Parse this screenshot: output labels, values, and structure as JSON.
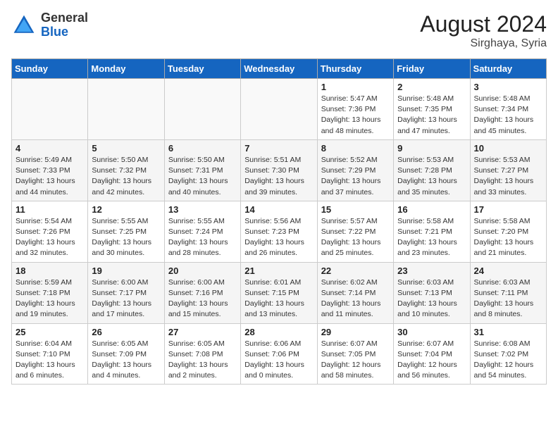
{
  "header": {
    "logo_general": "General",
    "logo_blue": "Blue",
    "month_year": "August 2024",
    "location": "Sirghaya, Syria"
  },
  "weekdays": [
    "Sunday",
    "Monday",
    "Tuesday",
    "Wednesday",
    "Thursday",
    "Friday",
    "Saturday"
  ],
  "weeks": [
    [
      {
        "day": "",
        "sunrise": "",
        "sunset": "",
        "daylight": "",
        "empty": true
      },
      {
        "day": "",
        "sunrise": "",
        "sunset": "",
        "daylight": "",
        "empty": true
      },
      {
        "day": "",
        "sunrise": "",
        "sunset": "",
        "daylight": "",
        "empty": true
      },
      {
        "day": "",
        "sunrise": "",
        "sunset": "",
        "daylight": "",
        "empty": true
      },
      {
        "day": "1",
        "sunrise": "Sunrise: 5:47 AM",
        "sunset": "Sunset: 7:36 PM",
        "daylight": "Daylight: 13 hours and 48 minutes.",
        "empty": false
      },
      {
        "day": "2",
        "sunrise": "Sunrise: 5:48 AM",
        "sunset": "Sunset: 7:35 PM",
        "daylight": "Daylight: 13 hours and 47 minutes.",
        "empty": false
      },
      {
        "day": "3",
        "sunrise": "Sunrise: 5:48 AM",
        "sunset": "Sunset: 7:34 PM",
        "daylight": "Daylight: 13 hours and 45 minutes.",
        "empty": false
      }
    ],
    [
      {
        "day": "4",
        "sunrise": "Sunrise: 5:49 AM",
        "sunset": "Sunset: 7:33 PM",
        "daylight": "Daylight: 13 hours and 44 minutes.",
        "empty": false
      },
      {
        "day": "5",
        "sunrise": "Sunrise: 5:50 AM",
        "sunset": "Sunset: 7:32 PM",
        "daylight": "Daylight: 13 hours and 42 minutes.",
        "empty": false
      },
      {
        "day": "6",
        "sunrise": "Sunrise: 5:50 AM",
        "sunset": "Sunset: 7:31 PM",
        "daylight": "Daylight: 13 hours and 40 minutes.",
        "empty": false
      },
      {
        "day": "7",
        "sunrise": "Sunrise: 5:51 AM",
        "sunset": "Sunset: 7:30 PM",
        "daylight": "Daylight: 13 hours and 39 minutes.",
        "empty": false
      },
      {
        "day": "8",
        "sunrise": "Sunrise: 5:52 AM",
        "sunset": "Sunset: 7:29 PM",
        "daylight": "Daylight: 13 hours and 37 minutes.",
        "empty": false
      },
      {
        "day": "9",
        "sunrise": "Sunrise: 5:53 AM",
        "sunset": "Sunset: 7:28 PM",
        "daylight": "Daylight: 13 hours and 35 minutes.",
        "empty": false
      },
      {
        "day": "10",
        "sunrise": "Sunrise: 5:53 AM",
        "sunset": "Sunset: 7:27 PM",
        "daylight": "Daylight: 13 hours and 33 minutes.",
        "empty": false
      }
    ],
    [
      {
        "day": "11",
        "sunrise": "Sunrise: 5:54 AM",
        "sunset": "Sunset: 7:26 PM",
        "daylight": "Daylight: 13 hours and 32 minutes.",
        "empty": false
      },
      {
        "day": "12",
        "sunrise": "Sunrise: 5:55 AM",
        "sunset": "Sunset: 7:25 PM",
        "daylight": "Daylight: 13 hours and 30 minutes.",
        "empty": false
      },
      {
        "day": "13",
        "sunrise": "Sunrise: 5:55 AM",
        "sunset": "Sunset: 7:24 PM",
        "daylight": "Daylight: 13 hours and 28 minutes.",
        "empty": false
      },
      {
        "day": "14",
        "sunrise": "Sunrise: 5:56 AM",
        "sunset": "Sunset: 7:23 PM",
        "daylight": "Daylight: 13 hours and 26 minutes.",
        "empty": false
      },
      {
        "day": "15",
        "sunrise": "Sunrise: 5:57 AM",
        "sunset": "Sunset: 7:22 PM",
        "daylight": "Daylight: 13 hours and 25 minutes.",
        "empty": false
      },
      {
        "day": "16",
        "sunrise": "Sunrise: 5:58 AM",
        "sunset": "Sunset: 7:21 PM",
        "daylight": "Daylight: 13 hours and 23 minutes.",
        "empty": false
      },
      {
        "day": "17",
        "sunrise": "Sunrise: 5:58 AM",
        "sunset": "Sunset: 7:20 PM",
        "daylight": "Daylight: 13 hours and 21 minutes.",
        "empty": false
      }
    ],
    [
      {
        "day": "18",
        "sunrise": "Sunrise: 5:59 AM",
        "sunset": "Sunset: 7:18 PM",
        "daylight": "Daylight: 13 hours and 19 minutes.",
        "empty": false
      },
      {
        "day": "19",
        "sunrise": "Sunrise: 6:00 AM",
        "sunset": "Sunset: 7:17 PM",
        "daylight": "Daylight: 13 hours and 17 minutes.",
        "empty": false
      },
      {
        "day": "20",
        "sunrise": "Sunrise: 6:00 AM",
        "sunset": "Sunset: 7:16 PM",
        "daylight": "Daylight: 13 hours and 15 minutes.",
        "empty": false
      },
      {
        "day": "21",
        "sunrise": "Sunrise: 6:01 AM",
        "sunset": "Sunset: 7:15 PM",
        "daylight": "Daylight: 13 hours and 13 minutes.",
        "empty": false
      },
      {
        "day": "22",
        "sunrise": "Sunrise: 6:02 AM",
        "sunset": "Sunset: 7:14 PM",
        "daylight": "Daylight: 13 hours and 11 minutes.",
        "empty": false
      },
      {
        "day": "23",
        "sunrise": "Sunrise: 6:03 AM",
        "sunset": "Sunset: 7:13 PM",
        "daylight": "Daylight: 13 hours and 10 minutes.",
        "empty": false
      },
      {
        "day": "24",
        "sunrise": "Sunrise: 6:03 AM",
        "sunset": "Sunset: 7:11 PM",
        "daylight": "Daylight: 13 hours and 8 minutes.",
        "empty": false
      }
    ],
    [
      {
        "day": "25",
        "sunrise": "Sunrise: 6:04 AM",
        "sunset": "Sunset: 7:10 PM",
        "daylight": "Daylight: 13 hours and 6 minutes.",
        "empty": false
      },
      {
        "day": "26",
        "sunrise": "Sunrise: 6:05 AM",
        "sunset": "Sunset: 7:09 PM",
        "daylight": "Daylight: 13 hours and 4 minutes.",
        "empty": false
      },
      {
        "day": "27",
        "sunrise": "Sunrise: 6:05 AM",
        "sunset": "Sunset: 7:08 PM",
        "daylight": "Daylight: 13 hours and 2 minutes.",
        "empty": false
      },
      {
        "day": "28",
        "sunrise": "Sunrise: 6:06 AM",
        "sunset": "Sunset: 7:06 PM",
        "daylight": "Daylight: 13 hours and 0 minutes.",
        "empty": false
      },
      {
        "day": "29",
        "sunrise": "Sunrise: 6:07 AM",
        "sunset": "Sunset: 7:05 PM",
        "daylight": "Daylight: 12 hours and 58 minutes.",
        "empty": false
      },
      {
        "day": "30",
        "sunrise": "Sunrise: 6:07 AM",
        "sunset": "Sunset: 7:04 PM",
        "daylight": "Daylight: 12 hours and 56 minutes.",
        "empty": false
      },
      {
        "day": "31",
        "sunrise": "Sunrise: 6:08 AM",
        "sunset": "Sunset: 7:02 PM",
        "daylight": "Daylight: 12 hours and 54 minutes.",
        "empty": false
      }
    ]
  ]
}
